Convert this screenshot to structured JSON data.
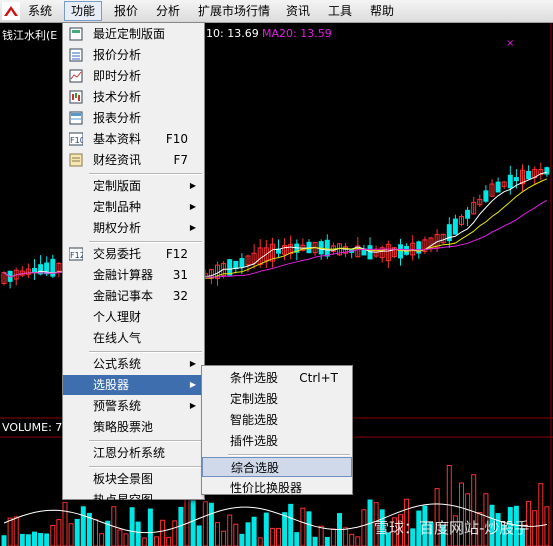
{
  "menubar": {
    "items": [
      "系统",
      "功能",
      "报价",
      "分析",
      "扩展市场行情",
      "资讯",
      "工具",
      "帮助"
    ],
    "active": "功能"
  },
  "chart": {
    "stock_name": "钱江水利(E",
    "ma10_text": "10: 13.69",
    "ma20_text": "MA20: 13.59",
    "volume_label": "VOLUME: 7",
    "colors": {
      "up": "#ff3030",
      "down": "#00e5e5",
      "ma5": "#ffffff",
      "ma10": "#e8e800",
      "ma20": "#e020e0",
      "grid": "#8b0000"
    }
  },
  "function_menu": [
    {
      "label": "最近定制版面",
      "icon": "recent-layout-icon"
    },
    {
      "label": "报价分析",
      "icon": "quote-analysis-icon"
    },
    {
      "label": "即时分析",
      "icon": "realtime-chart-icon"
    },
    {
      "label": "技术分析",
      "icon": "candlestick-icon"
    },
    {
      "label": "报表分析",
      "icon": "report-table-icon"
    },
    {
      "label": "基本资料",
      "shortcut": "F10",
      "icon": "f10-icon"
    },
    {
      "label": "财经资讯",
      "shortcut": "F7",
      "icon": "news-icon"
    },
    {
      "separator": true
    },
    {
      "label": "定制版面",
      "submenu": true
    },
    {
      "label": "定制品种",
      "submenu": true
    },
    {
      "label": "期权分析",
      "submenu": true
    },
    {
      "separator": true
    },
    {
      "label": "交易委托",
      "shortcut": "F12",
      "icon": "f12-icon"
    },
    {
      "label": "金融计算器",
      "shortcut": "31"
    },
    {
      "label": "金融记事本",
      "shortcut": "32"
    },
    {
      "label": "个人理财"
    },
    {
      "label": "在线人气"
    },
    {
      "separator": true
    },
    {
      "label": "公式系统",
      "submenu": true
    },
    {
      "label": "选股器",
      "submenu": true,
      "highlighted": true
    },
    {
      "label": "预警系统",
      "submenu": true
    },
    {
      "label": "策略股票池"
    },
    {
      "separator": true
    },
    {
      "label": "江恩分析系统"
    },
    {
      "separator": true
    },
    {
      "label": "板块全景图"
    },
    {
      "label": "热点星空图"
    }
  ],
  "stock_selector_submenu": [
    {
      "label": "条件选股",
      "shortcut": "Ctrl+T"
    },
    {
      "label": "定制选股"
    },
    {
      "label": "智能选股"
    },
    {
      "label": "插件选股"
    },
    {
      "separator": true
    },
    {
      "label": "综合选股",
      "highlighted": true
    },
    {
      "label": "性价比换股器"
    }
  ],
  "watermark": "雪球：百度网站-炒股手"
}
